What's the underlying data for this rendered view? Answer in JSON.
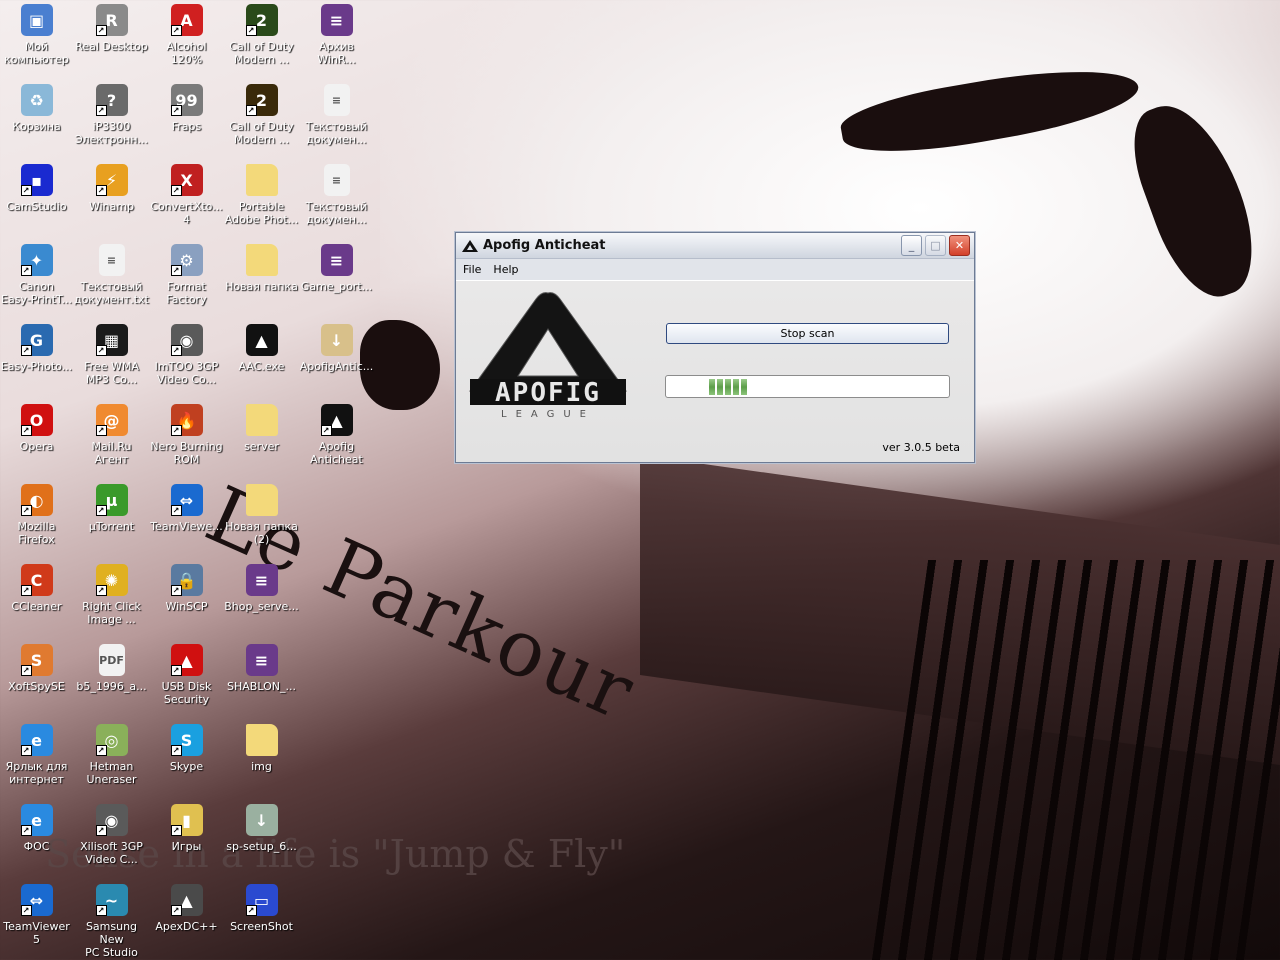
{
  "wallpaper": {
    "title": "Le Parkour",
    "slogan": "Sense in a life is \"Jump & Fly\""
  },
  "desktop_icons": [
    {
      "label": "Мой\nкомпьютер",
      "icon": "my-computer-icon",
      "color": "#4a7fd0",
      "glyph": "▣",
      "shortcut": false
    },
    {
      "label": "Real Desktop",
      "icon": "real-desktop-icon",
      "color": "#8a8a8a",
      "glyph": "R",
      "shortcut": true
    },
    {
      "label": "Alcohol 120%",
      "icon": "alcohol-icon",
      "color": "#d02020",
      "glyph": "A",
      "shortcut": true
    },
    {
      "label": "Call of Duty\nModern ...",
      "icon": "cod-icon",
      "color": "#2a4a1a",
      "glyph": "2",
      "shortcut": true
    },
    {
      "label": "Архив\nWinR...",
      "icon": "winrar-archive-icon",
      "color": "#6a3a8a",
      "glyph": "≡",
      "shortcut": false
    },
    {
      "label": "Корзина",
      "icon": "recycle-bin-icon",
      "color": "#8ab8d8",
      "glyph": "♻",
      "shortcut": false
    },
    {
      "label": "iP3300\nЭлектронн...",
      "icon": "printer-manual-icon",
      "color": "#6a6a6a",
      "glyph": "?",
      "shortcut": true
    },
    {
      "label": "Fraps",
      "icon": "fraps-icon",
      "color": "#7a7a7a",
      "glyph": "99",
      "shortcut": true
    },
    {
      "label": "Call of Duty\nModern ...",
      "icon": "cod-icon",
      "color": "#3a2a0a",
      "glyph": "2",
      "shortcut": true
    },
    {
      "label": "Текстовый\nдокумен...",
      "icon": "text-file-icon",
      "color": "#f2f2f2",
      "glyph": "≡",
      "shortcut": false
    },
    {
      "label": "CamStudio",
      "icon": "camstudio-icon",
      "color": "#1a2ad0",
      "glyph": "▪",
      "shortcut": true
    },
    {
      "label": "Winamp",
      "icon": "winamp-icon",
      "color": "#e8a020",
      "glyph": "⚡",
      "shortcut": true
    },
    {
      "label": "ConvertXto...\n4",
      "icon": "convertxtodvd-icon",
      "color": "#c02020",
      "glyph": "X",
      "shortcut": true
    },
    {
      "label": "Portable\nAdobe Phot...",
      "icon": "folder-icon",
      "color": "#f3d97a",
      "glyph": "",
      "shortcut": false
    },
    {
      "label": "Текстовый\nдокумен...",
      "icon": "text-file-icon",
      "color": "#f2f2f2",
      "glyph": "≡",
      "shortcut": false
    },
    {
      "label": "Canon\nEasy-PrintT...",
      "icon": "canon-icon",
      "color": "#3a8ad0",
      "glyph": "✦",
      "shortcut": true
    },
    {
      "label": "Текстовый\nдокумент.txt",
      "icon": "text-file-icon",
      "color": "#f2f2f2",
      "glyph": "≡",
      "shortcut": false
    },
    {
      "label": "Format\nFactory",
      "icon": "format-factory-icon",
      "color": "#8aa0c0",
      "glyph": "⚙",
      "shortcut": true
    },
    {
      "label": "Новая папка",
      "icon": "folder-icon",
      "color": "#f3d97a",
      "glyph": "",
      "shortcut": false
    },
    {
      "label": "Game_port...",
      "icon": "winrar-archive-icon",
      "color": "#6a3a8a",
      "glyph": "≡",
      "shortcut": false
    },
    {
      "label": "Easy-Photo...",
      "icon": "easy-photo-icon",
      "color": "#2a6ab0",
      "glyph": "G",
      "shortcut": true
    },
    {
      "label": "Free WMA\nMP3 Co...",
      "icon": "wma-converter-icon",
      "color": "#1a1a1a",
      "glyph": "▦",
      "shortcut": true
    },
    {
      "label": "ImTOO 3GP\nVideo Co...",
      "icon": "film-reel-icon",
      "color": "#5a5a5a",
      "glyph": "◉",
      "shortcut": true
    },
    {
      "label": "AAC.exe",
      "icon": "apofig-logo-icon",
      "color": "#111111",
      "glyph": "▲",
      "shortcut": false
    },
    {
      "label": "ApofigAntic...",
      "icon": "installer-icon",
      "color": "#d8c08a",
      "glyph": "↓",
      "shortcut": false
    },
    {
      "label": "Opera",
      "icon": "opera-icon",
      "color": "#d01010",
      "glyph": "O",
      "shortcut": true
    },
    {
      "label": "Mail.Ru Агент",
      "icon": "mailru-agent-icon",
      "color": "#f08a30",
      "glyph": "@",
      "shortcut": true
    },
    {
      "label": "Nero Burning\nROM",
      "icon": "nero-icon",
      "color": "#c04020",
      "glyph": "🔥",
      "shortcut": true
    },
    {
      "label": "server",
      "icon": "folder-icon",
      "color": "#f3d97a",
      "glyph": "",
      "shortcut": false
    },
    {
      "label": "Apofig\nAnticheat",
      "icon": "apofig-logo-icon",
      "color": "#111111",
      "glyph": "▲",
      "shortcut": true
    },
    {
      "label": "Mozilla Firefox",
      "icon": "firefox-icon",
      "color": "#e0701a",
      "glyph": "◐",
      "shortcut": true
    },
    {
      "label": "µTorrent",
      "icon": "utorrent-icon",
      "color": "#3a9a2a",
      "glyph": "µ",
      "shortcut": true
    },
    {
      "label": "TeamViewe...",
      "icon": "teamviewer-icon",
      "color": "#1a6ad0",
      "glyph": "⇔",
      "shortcut": true
    },
    {
      "label": "Новая папка\n(2)",
      "icon": "folder-icon",
      "color": "#f3d97a",
      "glyph": "",
      "shortcut": false
    },
    {
      "label": "CCleaner",
      "icon": "ccleaner-icon",
      "color": "#d03a1a",
      "glyph": "C",
      "shortcut": true
    },
    {
      "label": "Right Click\nImage ...",
      "icon": "right-click-image-icon",
      "color": "#e0b020",
      "glyph": "✺",
      "shortcut": true
    },
    {
      "label": "WinSCP",
      "icon": "winscp-icon",
      "color": "#5a7aa0",
      "glyph": "🔒",
      "shortcut": true
    },
    {
      "label": "Bhop_serve...",
      "icon": "winrar-archive-icon",
      "color": "#6a3a8a",
      "glyph": "≡",
      "shortcut": false
    },
    {
      "label": "XoftSpySE",
      "icon": "xoftspy-icon",
      "color": "#e07a30",
      "glyph": "S",
      "shortcut": true
    },
    {
      "label": "b5_1996_a...",
      "icon": "pdf-icon",
      "color": "#f2f2f2",
      "glyph": "PDF",
      "shortcut": false
    },
    {
      "label": "USB Disk\nSecurity",
      "icon": "usb-disk-security-icon",
      "color": "#d01010",
      "glyph": "▲",
      "shortcut": true
    },
    {
      "label": "SHABLON_...",
      "icon": "winrar-archive-icon",
      "color": "#6a3a8a",
      "glyph": "≡",
      "shortcut": false
    },
    {
      "label": "Ярлык для\nинтернет",
      "icon": "internet-explorer-icon",
      "color": "#2a8ae0",
      "glyph": "e",
      "shortcut": true
    },
    {
      "label": "Hetman\nUneraser",
      "icon": "hetman-uneraser-icon",
      "color": "#8ab05a",
      "glyph": "◎",
      "shortcut": true
    },
    {
      "label": "Skype",
      "icon": "skype-icon",
      "color": "#1aa0e0",
      "glyph": "S",
      "shortcut": true
    },
    {
      "label": "img",
      "icon": "folder-icon",
      "color": "#f3d97a",
      "glyph": "",
      "shortcut": false
    },
    {
      "label": "ФОС",
      "icon": "internet-explorer-icon",
      "color": "#2a8ae0",
      "glyph": "e",
      "shortcut": true
    },
    {
      "label": "Xilisoft 3GP\nVideo C...",
      "icon": "film-reel-icon",
      "color": "#5a5a5a",
      "glyph": "◉",
      "shortcut": true
    },
    {
      "label": "Игры",
      "icon": "games-icon",
      "color": "#e0c050",
      "glyph": "▮",
      "shortcut": true
    },
    {
      "label": "sp-setup_6...",
      "icon": "setup-disc-icon",
      "color": "#9ab0a0",
      "glyph": "↓",
      "shortcut": false
    },
    {
      "label": "TeamViewer 5",
      "icon": "teamviewer-icon",
      "color": "#1a6ad0",
      "glyph": "⇔",
      "shortcut": true
    },
    {
      "label": "Samsung New\nPC Studio",
      "icon": "samsung-pc-studio-icon",
      "color": "#2a8ab0",
      "glyph": "~",
      "shortcut": true
    },
    {
      "label": "ApexDC++",
      "icon": "apexdc-icon",
      "color": "#4a4a4a",
      "glyph": "▲",
      "shortcut": true
    },
    {
      "label": "ScreenShot",
      "icon": "screenshot-icon",
      "color": "#2a4ad0",
      "glyph": "▭",
      "shortcut": true
    }
  ],
  "icon_columns": [
    5,
    5,
    5,
    5,
    5,
    5,
    4,
    4,
    4,
    4,
    4,
    4
  ],
  "window": {
    "title": "Apofig Anticheat",
    "menu": [
      "File",
      "Help"
    ],
    "logo_text": "APOFIG",
    "logo_subtext": "LEAGUE",
    "stop_button": "Stop scan",
    "progress": {
      "mode": "marquee",
      "active_chunks": 5
    },
    "version": "ver 3.0.5 beta"
  }
}
